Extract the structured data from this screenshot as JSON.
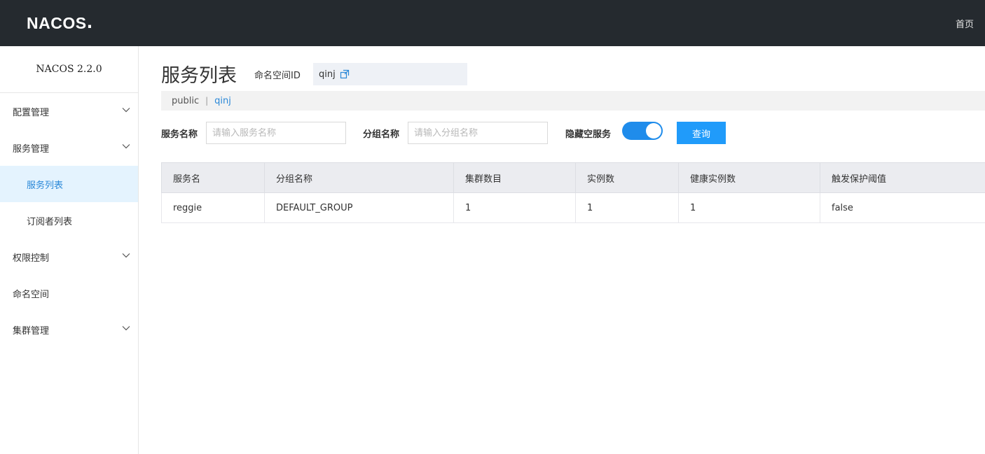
{
  "header": {
    "logo_text": "NACOS",
    "logo_dot": ".",
    "home_link": "首页"
  },
  "sidebar": {
    "version": "NACOS 2.2.0",
    "items": [
      {
        "label": "配置管理",
        "has_chevron": true
      },
      {
        "label": "服务管理",
        "has_chevron": true
      },
      {
        "label": "服务列表",
        "sub": true,
        "active": true
      },
      {
        "label": "订阅者列表",
        "sub": true
      },
      {
        "label": "权限控制",
        "has_chevron": true
      },
      {
        "label": "命名空间",
        "has_chevron": false
      },
      {
        "label": "集群管理",
        "has_chevron": true
      }
    ]
  },
  "main": {
    "title": "服务列表",
    "namespace_label": "命名空间ID",
    "namespace_value": "qinj",
    "namespace_bar": {
      "public": "public",
      "separator": "|",
      "current": "qinj"
    },
    "filters": {
      "service_label": "服务名称",
      "service_placeholder": "请输入服务名称",
      "group_label": "分组名称",
      "group_placeholder": "请输入分组名称",
      "hide_empty_label": "隐藏空服务",
      "hide_empty_on": true,
      "query_button": "查询"
    },
    "table": {
      "columns": [
        "服务名",
        "分组名称",
        "集群数目",
        "实例数",
        "健康实例数",
        "触发保护阈值"
      ],
      "rows": [
        [
          "reggie",
          "DEFAULT_GROUP",
          "1",
          "1",
          "1",
          "false"
        ]
      ]
    }
  },
  "colors": {
    "header_bg": "#252a2f",
    "accent": "#209bfa",
    "active_bg": "#e4f3fe",
    "link": "#2a88d8"
  }
}
